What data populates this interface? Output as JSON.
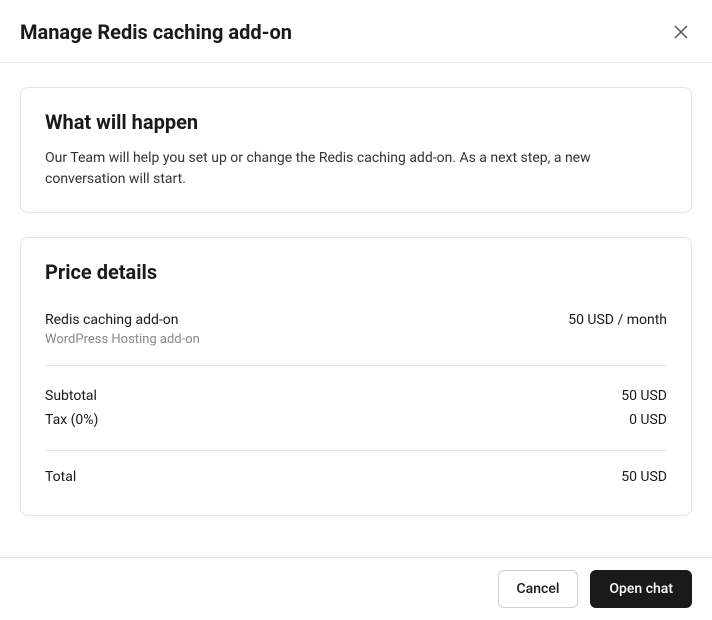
{
  "header": {
    "title": "Manage Redis caching add-on"
  },
  "info": {
    "title": "What will happen",
    "description": "Our Team will help you set up or change the Redis caching add-on. As a next step, a new conversation will start."
  },
  "price": {
    "title": "Price details",
    "item": {
      "name": "Redis caching add-on",
      "sub": "WordPress Hosting add-on",
      "price": "50 USD / month"
    },
    "subtotal": {
      "label": "Subtotal",
      "value": "50 USD"
    },
    "tax": {
      "label": "Tax (0%)",
      "value": "0 USD"
    },
    "total": {
      "label": "Total",
      "value": "50 USD"
    }
  },
  "footer": {
    "cancel": "Cancel",
    "open_chat": "Open chat"
  }
}
